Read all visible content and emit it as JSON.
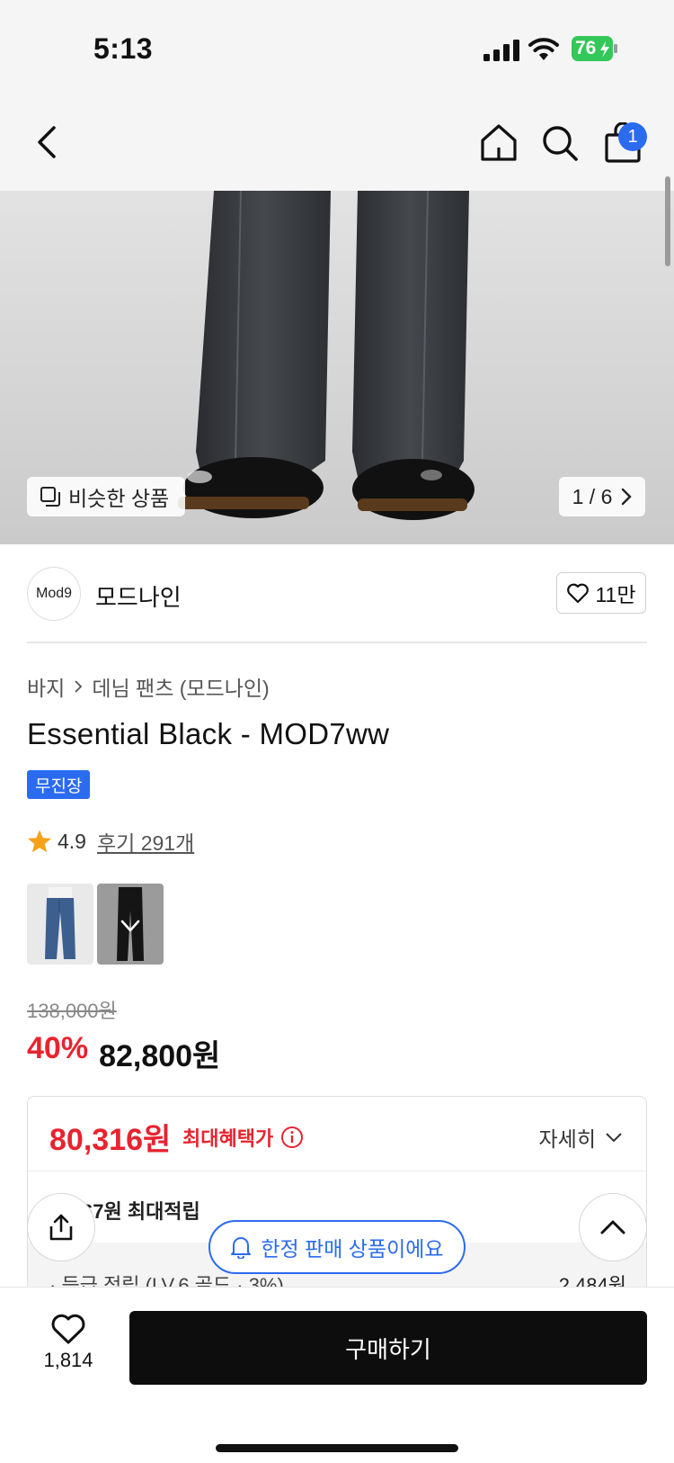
{
  "status": {
    "time": "5:13",
    "battery": "76"
  },
  "nav": {
    "cart_count": "1"
  },
  "hero": {
    "similar_label": "비슷한 상품",
    "pager": "1 / 6"
  },
  "brand": {
    "logo_text": "Mod9",
    "name": "모드나인",
    "likes": "11만"
  },
  "breadcrumb": {
    "category": "바지",
    "subcategory": "데님 팬츠 (모드나인)"
  },
  "product": {
    "title": "Essential Black - MOD7ww",
    "badge": "무진장",
    "rating": "4.9",
    "reviews": "후기 291개",
    "original_price": "138,000원",
    "discount": "40%",
    "sale_price": "82,800원"
  },
  "colors": {
    "accent_blue": "#2b6bf0",
    "sale_red": "#e8232f",
    "buy_black": "#0d0d0d",
    "star": "#f7a11b"
  },
  "benefit": {
    "max_price": "80,316원",
    "max_label": "최대혜택가",
    "detail_label": "자세히",
    "points_label": "67원 최대적립",
    "grade_label": "· 등급 적립 (LV.6 골드 · 3%)",
    "grade_value": "2,484원"
  },
  "limited": {
    "label": "한정 판매 상품이에요"
  },
  "bottom": {
    "likes": "1,814",
    "buy_label": "구매하기"
  }
}
